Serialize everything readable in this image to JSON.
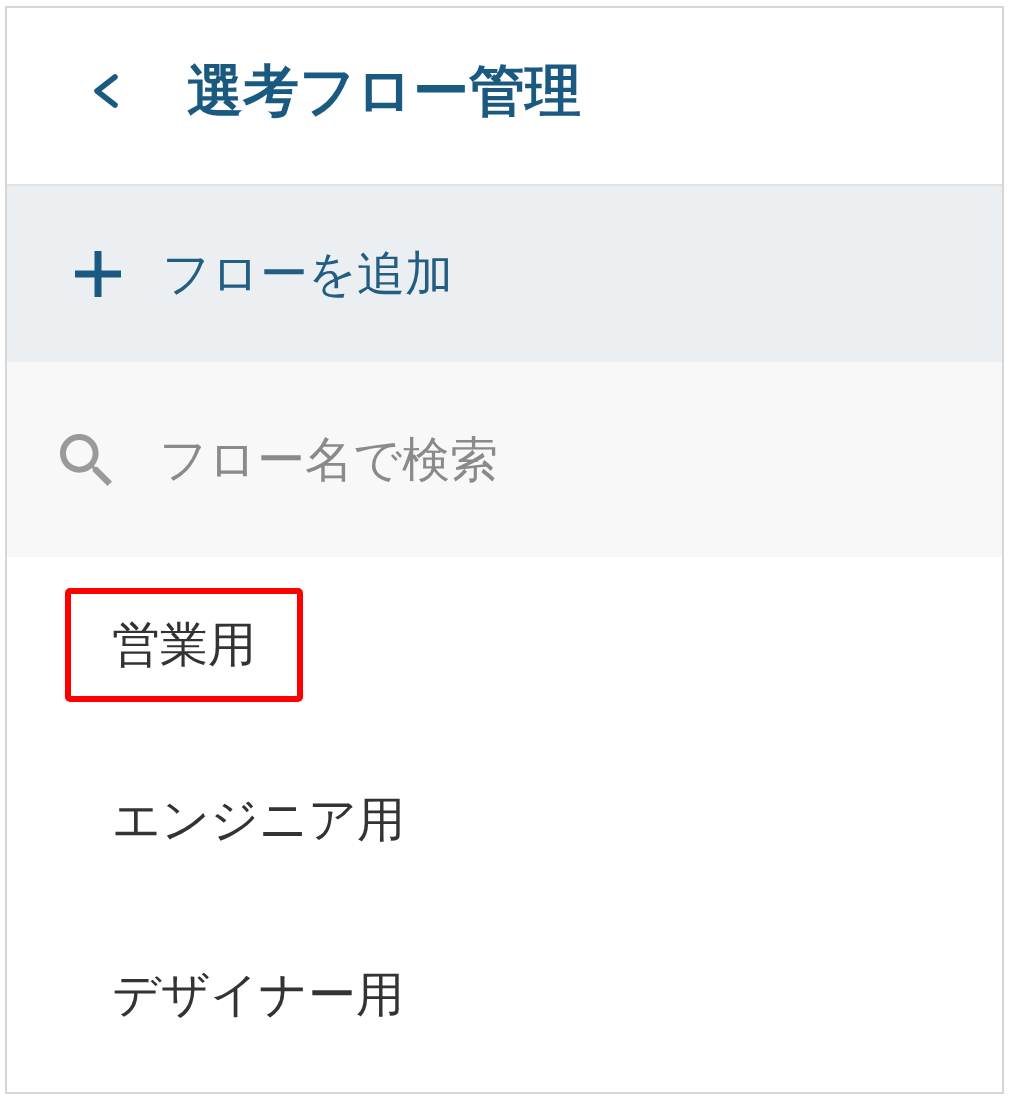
{
  "header": {
    "title": "選考フロー管理"
  },
  "add_button": {
    "label": "フローを追加"
  },
  "search": {
    "placeholder": "フロー名で検索"
  },
  "flows": [
    {
      "name": "営業用",
      "highlighted": true
    },
    {
      "name": "エンジニア用",
      "highlighted": false
    },
    {
      "name": "デザイナー用",
      "highlighted": false
    }
  ]
}
